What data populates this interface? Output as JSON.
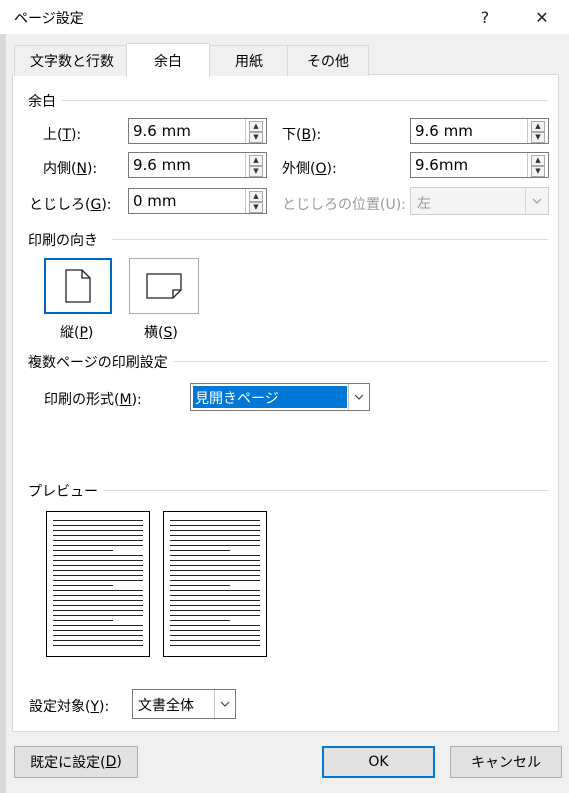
{
  "window": {
    "title": "ページ設定",
    "help_label": "?",
    "close_label": "✕"
  },
  "tabs": [
    {
      "label": "文字数と行数",
      "active": false
    },
    {
      "label": "余白",
      "active": true
    },
    {
      "label": "用紙",
      "active": false
    },
    {
      "label": "その他",
      "active": false
    }
  ],
  "margins": {
    "section_label": "余白",
    "top": {
      "label_pre": "上(",
      "key": "T",
      "label_post": "):",
      "value": "9.6 mm"
    },
    "bottom": {
      "label_pre": "下(",
      "key": "B",
      "label_post": "):",
      "value": "9.6 mm"
    },
    "inside": {
      "label_pre": "内側(",
      "key": "N",
      "label_post": "):",
      "value": "9.6 mm"
    },
    "outside": {
      "label_pre": "外側(",
      "key": "O",
      "label_post": "):",
      "value": "9.6mm"
    },
    "gutter": {
      "label_pre": "とじしろ(",
      "key": "G",
      "label_post": "):",
      "value": "0 mm"
    },
    "gutter_position": {
      "label": "とじしろの位置(U):",
      "value": "左"
    }
  },
  "orientation": {
    "section_label": "印刷の向き",
    "portrait": {
      "label_pre": "縦(",
      "key": "P",
      "label_post": ")"
    },
    "landscape": {
      "label_pre": "横(",
      "key": "S",
      "label_post": ")"
    }
  },
  "pages": {
    "section_label": "複数ページの印刷設定",
    "multiple_pages_label_pre": "印刷の形式(",
    "multiple_pages_key": "M",
    "multiple_pages_label_post": "):",
    "multiple_pages_value": "見開きページ"
  },
  "preview": {
    "section_label": "プレビュー"
  },
  "apply_to": {
    "label_pre": "設定対象(",
    "key": "Y",
    "label_post": "):",
    "value": "文書全体"
  },
  "footer": {
    "default_pre": "既定に設定(",
    "default_key": "D",
    "default_post": ")",
    "ok_label": "OK",
    "cancel_label": "キャンセル"
  },
  "colors": {
    "selection": "#0078d7",
    "focus_border": "#0067c0"
  }
}
